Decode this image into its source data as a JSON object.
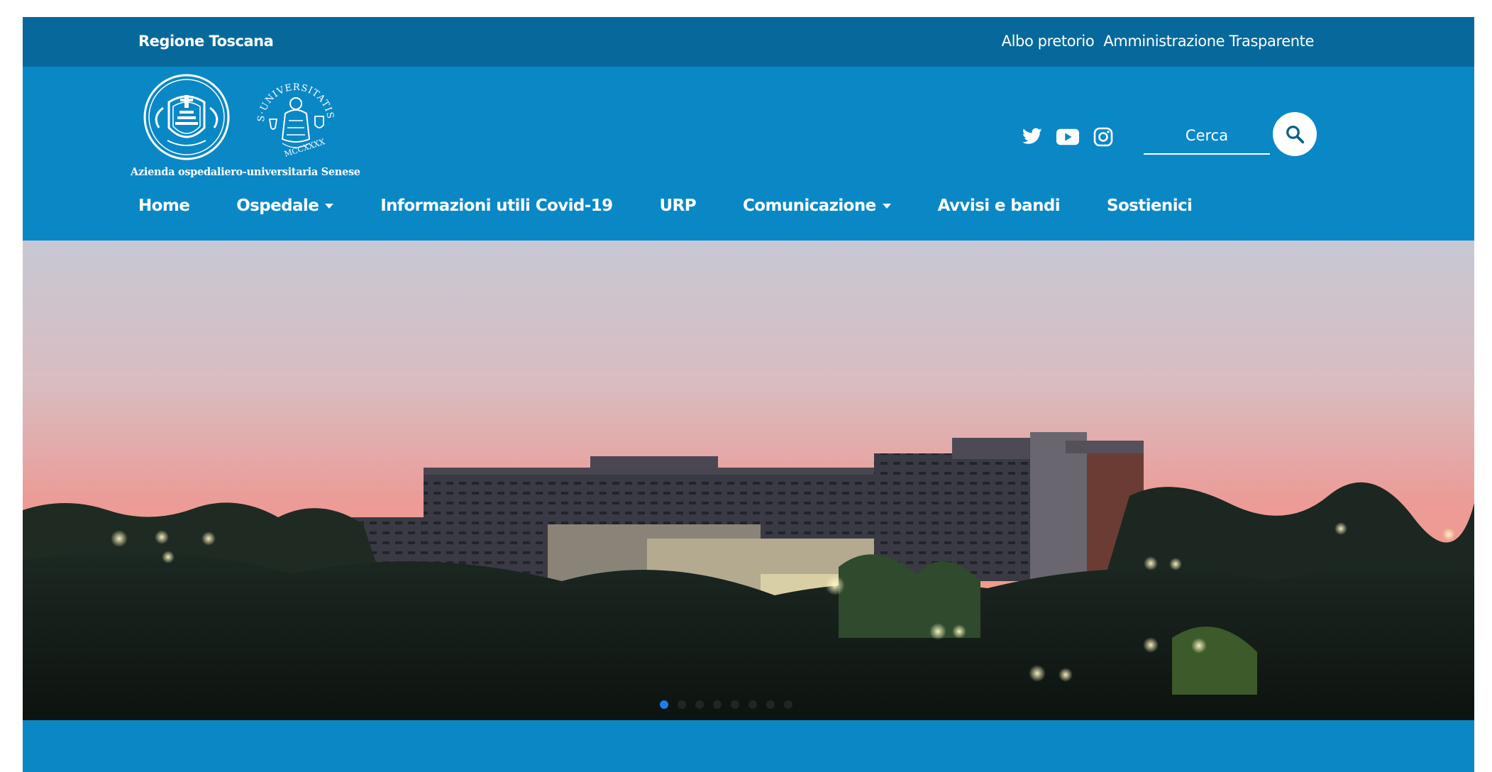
{
  "topbar": {
    "region": "Regione Toscana",
    "links": [
      "Albo pretorio",
      "Amministrazione Trasparente"
    ]
  },
  "brand": {
    "caption": "Azienda ospedaliero-universitaria Senese",
    "seal_text": "S.UNIVERSITATIS SENARUM MCCXXXX"
  },
  "social": [
    "twitter-icon",
    "youtube-icon",
    "instagram-icon"
  ],
  "search": {
    "placeholder": "Cerca"
  },
  "nav": {
    "items": [
      {
        "label": "Home",
        "dropdown": false
      },
      {
        "label": "Ospedale",
        "dropdown": true
      },
      {
        "label": "Informazioni utili Covid-19",
        "dropdown": false
      },
      {
        "label": "URP",
        "dropdown": false
      },
      {
        "label": "Comunicazione",
        "dropdown": true
      },
      {
        "label": "Avvisi e bandi",
        "dropdown": false
      },
      {
        "label": "Sostienici",
        "dropdown": false
      }
    ]
  },
  "carousel": {
    "slides": 8,
    "active_index": 0
  },
  "colors": {
    "brand_blue": "#0a88c6",
    "topbar_blue": "#07699b",
    "dot_active": "#1e7de8"
  }
}
